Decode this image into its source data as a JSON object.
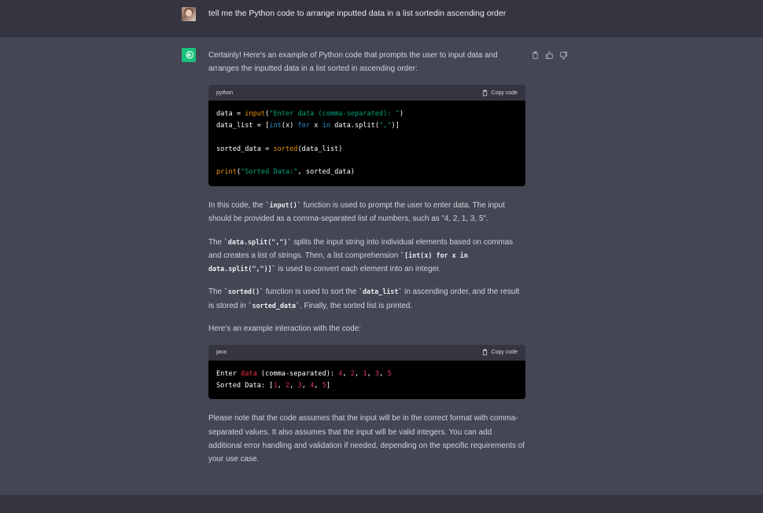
{
  "user": {
    "message": "tell me the Python code to arrange inputted data in a list sortedin ascending order"
  },
  "assistant": {
    "intro": "Certainly! Here's an example of Python code that prompts the user to input data and arranges the inputted data in a list sorted in ascending order:",
    "code1": {
      "language": "python",
      "copy_label": "Copy code"
    },
    "para1": {
      "a": "In this code, the ",
      "code": "`input()`",
      "b": " function is used to prompt the user to enter data. The input should be provided as a comma-separated list of numbers, such as \"4, 2, 1, 3, 5\"."
    },
    "para2": {
      "a": "The ",
      "code1": "`data.split(\",\")`",
      "b": " splits the input string into individual elements based on commas and creates a list of strings. Then, a list comprehension ",
      "code2": "`[int(x) for x in data.split(\",\")]`",
      "c": " is used to convert each element into an integer."
    },
    "para3": {
      "a": "The ",
      "code1": "`sorted()`",
      "b": " function is used to sort the ",
      "code2": "`data_list`",
      "c": " in ascending order, and the result is stored in ",
      "code3": "`sorted_data`",
      "d": ". Finally, the sorted list is printed."
    },
    "para4": "Here's an example interaction with the code:",
    "code2": {
      "language": "java",
      "copy_label": "Copy code"
    },
    "outro": "Please note that the code assumes that the input will be in the correct format with comma-separated values. It also assumes that the input will be valid integers. You can add additional error handling and validation if needed, depending on the specific requirements of your use case."
  },
  "icons": {
    "copy": "clipboard-icon",
    "like": "thumbs-up-icon",
    "dislike": "thumbs-down-icon",
    "assistant_logo": "openai-logo-icon"
  },
  "colors": {
    "user_bg": "#343541",
    "assistant_bg": "#444654",
    "logo_bg": "#19c37d"
  }
}
